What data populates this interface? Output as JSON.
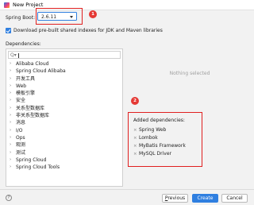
{
  "window": {
    "title": "New Project"
  },
  "spring_boot": {
    "label": "Spring Boot:",
    "value": "2.6.11"
  },
  "download_option": {
    "label": "Download pre-built shared indexes for JDK and Maven libraries",
    "checked": true
  },
  "dependencies": {
    "label": "Dependencies:",
    "search_icon": "Q▾",
    "categories": [
      "Alibaba Cloud",
      "Spring Cloud Alibaba",
      "开发工具",
      "Web",
      "模板引擎",
      "安全",
      "关系型数据库",
      "非关系型数据库",
      "消息",
      "I/O",
      "Ops",
      "观测",
      "测试",
      "Spring Cloud",
      "Spring Cloud Tools"
    ]
  },
  "detail": {
    "empty_text": "Nothing selected"
  },
  "added": {
    "label": "Added dependencies:",
    "items": [
      "Spring Web",
      "Lombok",
      "MyBatis Framework",
      "MySQL Driver"
    ]
  },
  "annotations": [
    "1",
    "2"
  ],
  "footer": {
    "help": "?",
    "previous_prefix": "",
    "previous_mnemonic": "P",
    "previous_rest": "revious",
    "create_label": "Create",
    "cancel_label": "Cancel"
  },
  "colors": {
    "accent": "#2f7fe0",
    "annotation": "#e02020"
  }
}
